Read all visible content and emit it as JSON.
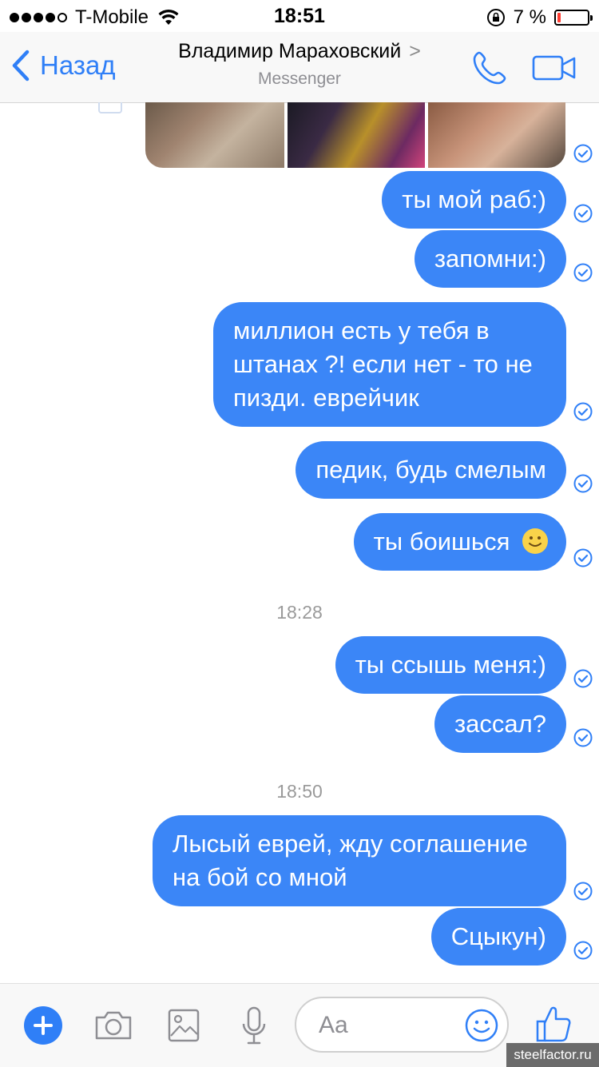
{
  "status_bar": {
    "carrier": "T-Mobile",
    "time": "18:51",
    "battery": "7 %",
    "battery_level": 0.07
  },
  "nav": {
    "back_label": "Назад",
    "title": "Владимир Мараховский",
    "title_chevron": ">",
    "subtitle": "Messenger"
  },
  "messages": [
    {
      "text": "ты мой раб:)"
    },
    {
      "text": "запомни:)"
    },
    {
      "text": "миллион есть у тебя в штанах ?! если нет - то не пизди. еврейчик"
    },
    {
      "text": "педик, будь смелым"
    },
    {
      "text": "ты боишься"
    },
    {
      "text": "ты ссышь меня:)"
    },
    {
      "text": "зассал?"
    },
    {
      "text": "Лысый еврей, жду соглашение на бой со мной"
    },
    {
      "text": "Сцыкун)"
    }
  ],
  "timestamps": [
    "18:28",
    "18:50"
  ],
  "composer": {
    "placeholder": "Aa"
  },
  "watermark": "steelfactor.ru",
  "colors": {
    "accent": "#2f7ff7",
    "bubble": "#3b86f7",
    "battery_low": "#ff3b30"
  },
  "icons": [
    "back-chevron-icon",
    "phone-icon",
    "video-call-icon",
    "plus-icon",
    "camera-icon",
    "gallery-icon",
    "microphone-icon",
    "emoji-icon",
    "like-icon",
    "delivered-check-icon"
  ]
}
